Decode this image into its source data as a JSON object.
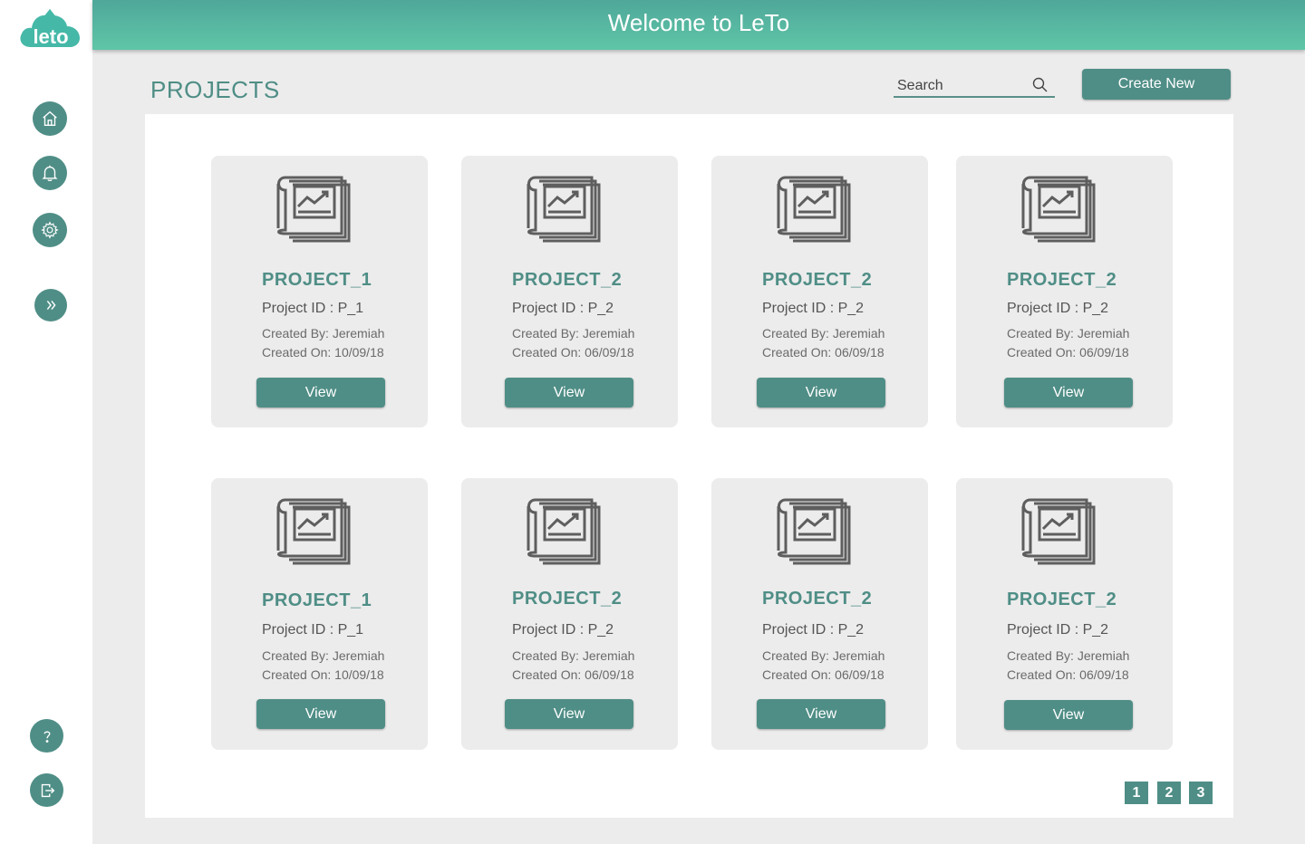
{
  "app": {
    "logo_text": "leto"
  },
  "header": {
    "title": "Welcome to LeTo"
  },
  "sidebar": {
    "items": [
      {
        "name": "home-icon"
      },
      {
        "name": "bell-icon"
      },
      {
        "name": "gear-icon"
      },
      {
        "name": "chevron-double-right-icon"
      },
      {
        "name": "help-icon"
      },
      {
        "name": "logout-icon"
      }
    ]
  },
  "page": {
    "title": "PROJECTS"
  },
  "search": {
    "placeholder": "Search"
  },
  "toolbar": {
    "create_label": "Create New"
  },
  "projects": [
    {
      "name": "PROJECT_1",
      "id": "Project ID : P_1",
      "created_by": "Created By:  Jeremiah",
      "created_on": "Created On:  10/09/18",
      "view_label": "View"
    },
    {
      "name": "PROJECT_2",
      "id": "Project ID : P_2",
      "created_by": "Created By:  Jeremiah",
      "created_on": "Created On:  06/09/18",
      "view_label": "View"
    },
    {
      "name": "PROJECT_2",
      "id": "Project ID : P_2",
      "created_by": "Created By:  Jeremiah",
      "created_on": "Created On:  06/09/18",
      "view_label": "View"
    },
    {
      "name": "PROJECT_2",
      "id": "Project ID : P_2",
      "created_by": "Created By:  Jeremiah",
      "created_on": "Created On:  06/09/18",
      "view_label": "View"
    },
    {
      "name": "PROJECT_1",
      "id": "Project ID : P_1",
      "created_by": "Created By:  Jeremiah",
      "created_on": "Created On:  10/09/18",
      "view_label": "View"
    },
    {
      "name": "PROJECT_2",
      "id": "Project ID : P_2",
      "created_by": "Created By:  Jeremiah",
      "created_on": "Created On:  06/09/18",
      "view_label": "View"
    },
    {
      "name": "PROJECT_2",
      "id": "Project ID : P_2",
      "created_by": "Created By:  Jeremiah",
      "created_on": "Created On:  06/09/18",
      "view_label": "View"
    },
    {
      "name": "PROJECT_2",
      "id": "Project ID : P_2",
      "created_by": "Created By:  Jeremiah",
      "created_on": "Created On:  06/09/18",
      "view_label": "View"
    }
  ],
  "pagination": {
    "pages": [
      "1",
      "2",
      "3"
    ]
  },
  "colors": {
    "accent": "#4f8e86",
    "header_top": "#4fa79a",
    "header_bottom": "#5fc6a7"
  }
}
